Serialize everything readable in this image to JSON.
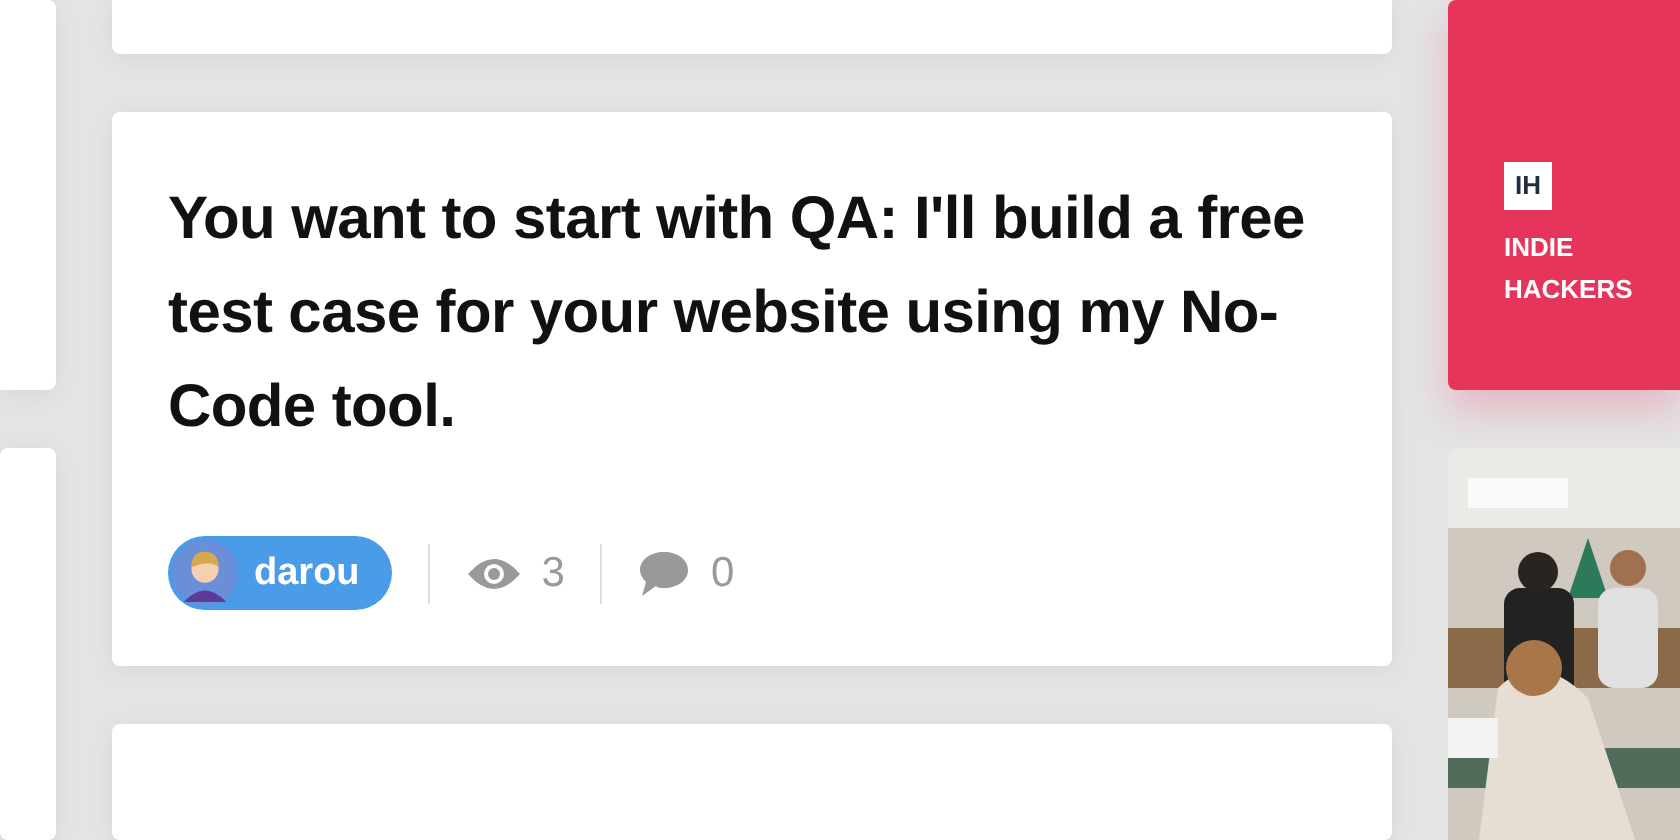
{
  "post": {
    "title": "You want to start with QA: I'll build a free test case for your website using my No-Code tool.",
    "author": "darou",
    "views": "3",
    "comments": "0"
  },
  "sidebar": {
    "promo": {
      "logo": "IH",
      "label": "INDIE HACKERS"
    }
  }
}
